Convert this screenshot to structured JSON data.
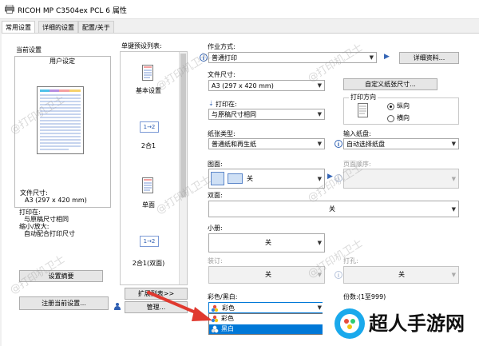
{
  "window": {
    "title": "RICOH MP C3504ex PCL 6 属性"
  },
  "tabs": [
    "常用设置",
    "详细的设置",
    "配置/关于"
  ],
  "left": {
    "current_settings_label": "当前设置",
    "user_setting_label": "用户设定",
    "summary_lines": [
      "文件尺寸:",
      "A3 (297 x 420 mm)",
      "打印在:",
      "与原稿尺寸相同",
      "缩小/放大:",
      "自动配合打印尺寸"
    ],
    "settings_summary_button": "设置摘要",
    "register_button": "注册当前设置..."
  },
  "presets": {
    "label": "单键预设列表:",
    "items": [
      {
        "label": "基本设置",
        "icon": "document-icon"
      },
      {
        "label": "2合1",
        "icon": "two-in-one-icon",
        "badge": "1→2"
      },
      {
        "label": "单面",
        "icon": "document-icon"
      },
      {
        "label": "2合1(双面)",
        "icon": "two-in-one-duplex-icon",
        "badge": "1→2"
      }
    ],
    "expand_button": "扩展列表>>",
    "manage_button": "管理..."
  },
  "job": {
    "label": "作业方式:",
    "value": "普通打印",
    "details_button": "详细资料..."
  },
  "paper_size": {
    "label": "文件尺寸:",
    "value": "A3 (297 x 420 mm)",
    "custom_button": "自定义纸张尺寸..."
  },
  "print_on": {
    "label": "打印在:",
    "value": "与原稿尺寸相同"
  },
  "orientation": {
    "label": "打印方向",
    "options": [
      "纵向",
      "横向"
    ],
    "selected": "纵向"
  },
  "paper_type": {
    "label": "纸张类型:",
    "value": "普通纸和再生纸"
  },
  "input_tray": {
    "label": "输入纸盘:",
    "value": "自动选择纸盘"
  },
  "duplex": {
    "label": "图面:",
    "value": "关"
  },
  "page_order": {
    "label": "页面顺序:",
    "value": ""
  },
  "double_sided": {
    "label": "双面:",
    "value": "关"
  },
  "booklet": {
    "label": "小册:",
    "value": "关"
  },
  "staple": {
    "label": "装订:",
    "value": "关"
  },
  "punch": {
    "label": "打孔:",
    "value": "关"
  },
  "color_mode": {
    "label": "彩色/黑白:",
    "value": "彩色",
    "options": [
      {
        "label": "彩色",
        "highlighted": false
      },
      {
        "label": "黑白",
        "highlighted": true
      }
    ]
  },
  "copies": {
    "label": "份数:(1至999)",
    "value": "1"
  },
  "watermarks": {
    "text": "@打印机卫士"
  },
  "overlay": {
    "logo_text": "超人手游网"
  },
  "colors": {
    "accent": "#0078d7",
    "arrow": "#e0392f",
    "link": "#3565b5"
  }
}
